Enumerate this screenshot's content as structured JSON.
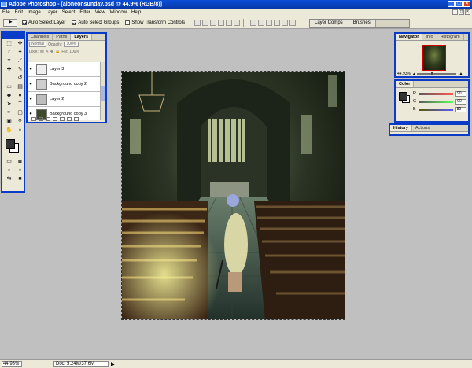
{
  "window": {
    "title": "Adobe Photoshop - [aloneonsunday.psd @ 44.9% (RGB/8)]",
    "controls": [
      "_",
      "□",
      "×"
    ]
  },
  "menu": [
    "File",
    "Edit",
    "Image",
    "Layer",
    "Select",
    "Filter",
    "View",
    "Window",
    "Help"
  ],
  "options": {
    "auto_select_layer": "Auto Select Layer",
    "auto_select_groups": "Auto Select Groups",
    "show_transform_controls": "Show Transform Controls"
  },
  "well_tabs": [
    "Layer Comps",
    "Brushes"
  ],
  "layers_panel": {
    "tabs": [
      "Channels",
      "Paths",
      "Layers"
    ],
    "blend_mode": "Normal",
    "opacity_label": "Opacity:",
    "opacity": "100%",
    "fill_label": "Fill:",
    "fill": "100%",
    "lock_label": "Lock:",
    "rows": [
      {
        "name": "Layer 3"
      },
      {
        "name": "Background copy 2"
      },
      {
        "name": "Layer 2"
      },
      {
        "name": "Background copy 3"
      }
    ]
  },
  "navigator_panel": {
    "tabs": [
      "Navigator",
      "Info",
      "Histogram"
    ],
    "zoom": "44.93%"
  },
  "color_panel": {
    "tab": "Color",
    "r_label": "R",
    "g_label": "G",
    "b_label": "B",
    "r": "90",
    "g": "90",
    "b": "89"
  },
  "history_panel": {
    "tabs": [
      "History",
      "Actions"
    ]
  },
  "status": {
    "zoom": "44.93%",
    "doc": "Doc: 5.24M/37.6M",
    "arrow": "▶"
  },
  "colors": {
    "accent": "#0a3cc8",
    "chrome": "#ece9d8",
    "workspace": "#c0c0c0"
  }
}
